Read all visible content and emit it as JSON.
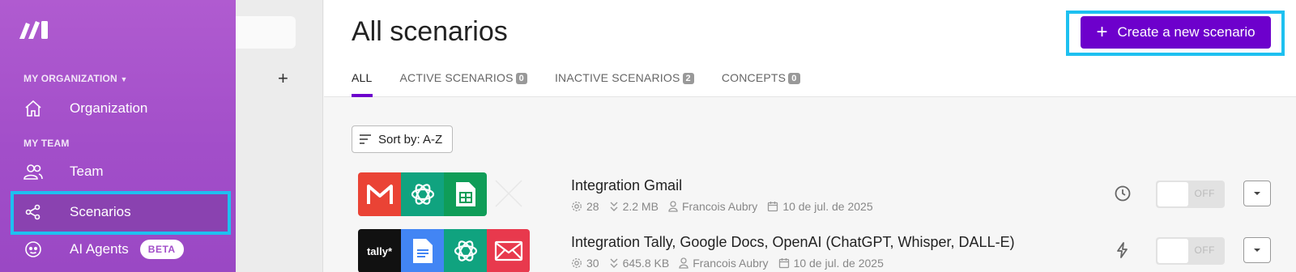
{
  "sidebar": {
    "logo_icon": "make-logo-icon",
    "org_section": "MY ORGANIZATION",
    "team_section": "MY TEAM",
    "items": [
      {
        "label": "Organization",
        "icon": "home-icon"
      },
      {
        "label": "Team",
        "icon": "users-icon"
      },
      {
        "label": "Scenarios",
        "icon": "share-nodes-icon",
        "active": true
      },
      {
        "label": "AI Agents",
        "icon": "ai-agent-icon",
        "badge": "BETA"
      }
    ],
    "highlight_color": "#1ec0f0"
  },
  "folders": {
    "add_symbol": "+"
  },
  "header": {
    "title": "All scenarios",
    "create_label": "Create a new scenario",
    "create_symbol": "+",
    "accent": "#6d00cc"
  },
  "tabs": [
    {
      "label": "ALL",
      "count": null,
      "active": true
    },
    {
      "label": "ACTIVE SCENARIOS",
      "count": "0"
    },
    {
      "label": "INACTIVE SCENARIOS",
      "count": "2"
    },
    {
      "label": "CONCEPTS",
      "count": "0"
    }
  ],
  "sort": {
    "label": "Sort by: A-Z"
  },
  "scenarios": [
    {
      "title": "Integration Gmail",
      "operations": "28",
      "size": "2.2 MB",
      "owner": "Francois Aubry",
      "date": "10 de jul. de 2025",
      "apps": [
        "gmail-icon",
        "openai-icon",
        "google-sheets-icon"
      ],
      "schedule_icon": "clock-icon",
      "toggle": "OFF"
    },
    {
      "title": "Integration Tally, Google Docs, OpenAI (ChatGPT, Whisper, DALL-E)",
      "operations": "30",
      "size": "645.8 KB",
      "owner": "Francois Aubry",
      "date": "10 de jul. de 2025",
      "apps": [
        "tally-icon",
        "google-docs-icon",
        "openai-icon",
        "email-icon"
      ],
      "tally_text": "tally*",
      "schedule_icon": "lightning-icon",
      "toggle": "OFF"
    }
  ]
}
